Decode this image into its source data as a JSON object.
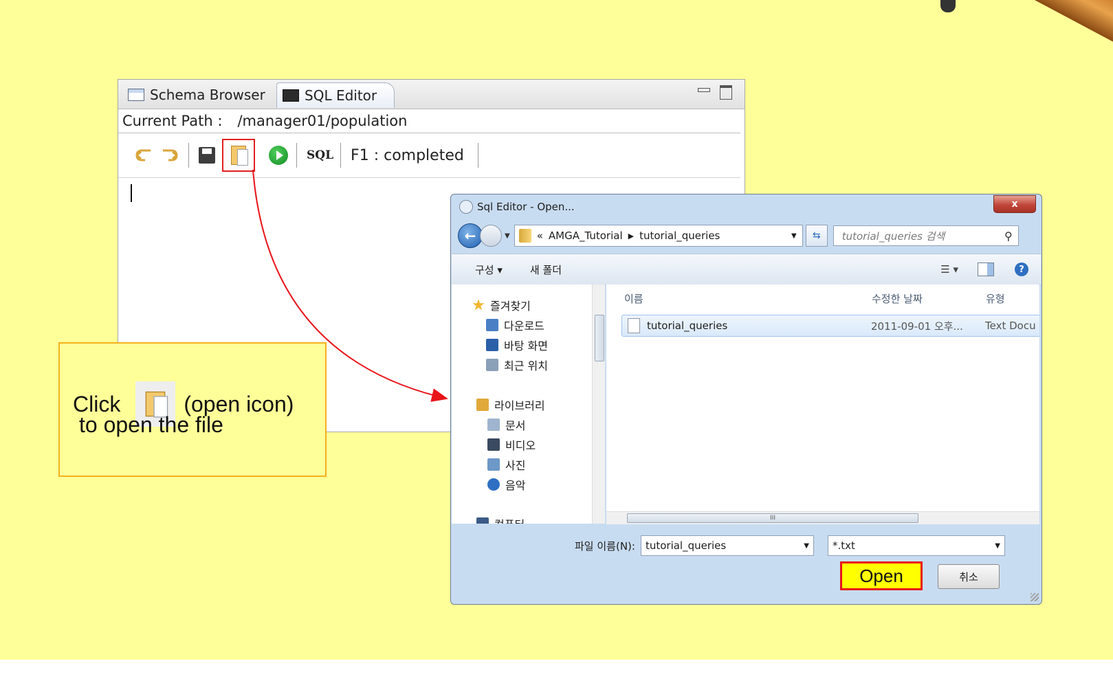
{
  "editor": {
    "tabs": [
      {
        "label": "Schema Browser"
      },
      {
        "label": "SQL Editor"
      }
    ],
    "path_label": "Current Path :",
    "path_value": "/manager01/population",
    "toolbar": {
      "sql_label": "SQL",
      "status": "F1 : completed"
    }
  },
  "callout": {
    "click": "Click",
    "icon_hint": "(open icon)",
    "line2": "to open the file"
  },
  "dialog": {
    "title": "Sql Editor - Open...",
    "close_label": "x",
    "address": {
      "prefix": "«",
      "crumbs": [
        "AMGA_Tutorial",
        "tutorial_queries"
      ]
    },
    "search_placeholder": "tutorial_queries 검색",
    "commands": {
      "organize": "구성 ▾",
      "new_folder": "새 폴더",
      "help": "?"
    },
    "nav_items": [
      {
        "label": "즐겨찾기",
        "icon": "star-icon",
        "color": "#f2b632"
      },
      {
        "label": "다운로드",
        "icon": "downloads-icon",
        "color": "#4a7fc6"
      },
      {
        "label": "바탕 화면",
        "icon": "desktop-icon",
        "color": "#2b5fa8"
      },
      {
        "label": "최근 위치",
        "icon": "recent-places-icon",
        "color": "#8aa0b8"
      },
      {
        "label": "라이브러리",
        "icon": "libraries-icon",
        "color": "#e0a93a"
      },
      {
        "label": "문서",
        "icon": "documents-icon",
        "color": "#9fb5cf"
      },
      {
        "label": "비디오",
        "icon": "videos-icon",
        "color": "#3a4a60"
      },
      {
        "label": "사진",
        "icon": "pictures-icon",
        "color": "#6d98c8"
      },
      {
        "label": "음악",
        "icon": "music-icon",
        "color": "#2f6fc3"
      },
      {
        "label": "컴퓨터",
        "icon": "computer-icon",
        "color": "#3b5b86"
      }
    ],
    "columns": [
      "이름",
      "수정한 날짜",
      "유형"
    ],
    "files": [
      {
        "name": "tutorial_queries",
        "date": "2011-09-01 오후...",
        "type": "Text Docu"
      }
    ],
    "filename_label": "파일 이름(N):",
    "filename_value": "tutorial_queries",
    "filetype_value": "*.txt",
    "open_label": "Open",
    "cancel_label": "취소"
  }
}
